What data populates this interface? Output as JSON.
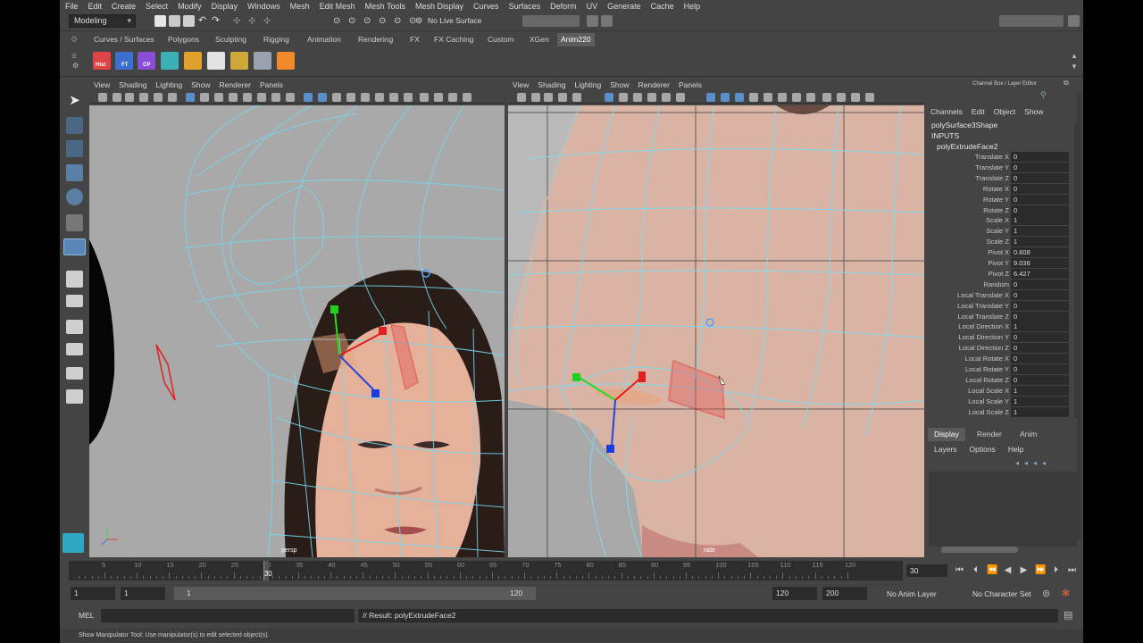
{
  "menu": [
    "File",
    "Edit",
    "Create",
    "Select",
    "Modify",
    "Display",
    "Windows",
    "Mesh",
    "Edit Mesh",
    "Mesh Tools",
    "Mesh Display",
    "Curves",
    "Surfaces",
    "Deform",
    "UV",
    "Generate",
    "Cache",
    "Help"
  ],
  "status": {
    "workspace": "Modeling",
    "live_surface": "No Live Surface"
  },
  "shelf_tabs": [
    "Curves / Surfaces",
    "Polygons",
    "Sculpting",
    "Rigging",
    "Animation",
    "Rendering",
    "FX",
    "FX Caching",
    "Custom",
    "XGen",
    "Anim220"
  ],
  "shelf_buttons": [
    "Hist",
    "FT",
    "CP"
  ],
  "panel_menu": [
    "View",
    "Shading",
    "Lighting",
    "Show",
    "Renderer",
    "Panels"
  ],
  "viewports": {
    "left_label": "persp",
    "right_label": "side"
  },
  "channel_box": {
    "header": "Channel Box / Layer Editor",
    "menu": [
      "Channels",
      "Edit",
      "Object",
      "Show"
    ],
    "object": "polySurface3Shape",
    "inputs_label": "INPUTS",
    "node": "polyExtrudeFace2",
    "attributes": [
      {
        "name": "Translate X",
        "value": "0"
      },
      {
        "name": "Translate Y",
        "value": "0"
      },
      {
        "name": "Translate Z",
        "value": "0"
      },
      {
        "name": "Rotate X",
        "value": "0"
      },
      {
        "name": "Rotate Y",
        "value": "0"
      },
      {
        "name": "Rotate Z",
        "value": "0"
      },
      {
        "name": "Scale X",
        "value": "1"
      },
      {
        "name": "Scale Y",
        "value": "1"
      },
      {
        "name": "Scale Z",
        "value": "1"
      },
      {
        "name": "Pivot X",
        "value": "0.608"
      },
      {
        "name": "Pivot Y",
        "value": "9.036"
      },
      {
        "name": "Pivot Z",
        "value": "6.427"
      },
      {
        "name": "Random",
        "value": "0"
      },
      {
        "name": "Local Translate X",
        "value": "0"
      },
      {
        "name": "Local Translate Y",
        "value": "0"
      },
      {
        "name": "Local Translate Z",
        "value": "0"
      },
      {
        "name": "Local Direction X",
        "value": "1"
      },
      {
        "name": "Local Direction Y",
        "value": "0"
      },
      {
        "name": "Local Direction Z",
        "value": "0"
      },
      {
        "name": "Local Rotate X",
        "value": "0"
      },
      {
        "name": "Local Rotate Y",
        "value": "0"
      },
      {
        "name": "Local Rotate Z",
        "value": "0"
      },
      {
        "name": "Local Scale X",
        "value": "1"
      },
      {
        "name": "Local Scale Y",
        "value": "1"
      },
      {
        "name": "Local Scale Z",
        "value": "1"
      }
    ]
  },
  "layer_editor": {
    "tabs": [
      "Display",
      "Render",
      "Anim"
    ],
    "menu": [
      "Layers",
      "Options",
      "Help"
    ]
  },
  "timeline": {
    "ticks": [
      "5",
      "10",
      "15",
      "20",
      "25",
      "30",
      "35",
      "40",
      "45",
      "50",
      "55",
      "60",
      "65",
      "70",
      "75",
      "80",
      "85",
      "90",
      "95",
      "100",
      "105",
      "110",
      "115",
      "120"
    ],
    "current": "30",
    "current_field": "30"
  },
  "range": {
    "start": "1",
    "start2": "1",
    "slider_start": "1",
    "slider_end": "120",
    "end": "120",
    "end2": "200",
    "anim_layer": "No Anim Layer",
    "character_set": "No Character Set"
  },
  "command": {
    "lang": "MEL",
    "result": "// Result: polyExtrudeFace2"
  },
  "help_line": "Show Manipulator Tool: Use manipulator(s) to edit selected object(s)."
}
